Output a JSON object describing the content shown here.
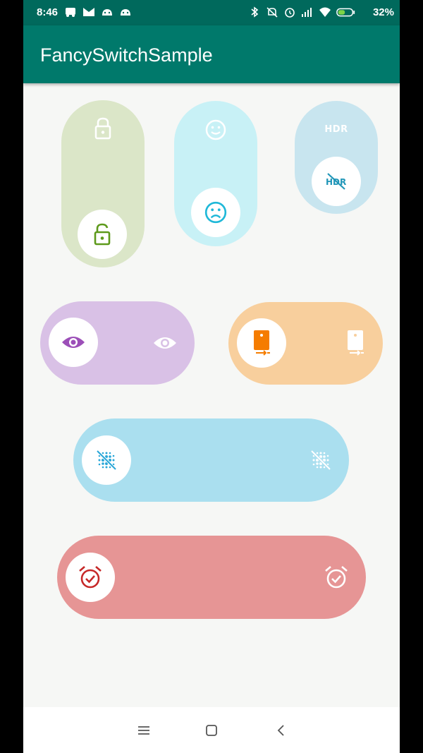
{
  "status_bar": {
    "time": "8:46",
    "battery_percent": "32%",
    "left_icons": [
      "train-icon",
      "mail-icon",
      "android-icon",
      "android-icon"
    ],
    "right_icons": [
      "bluetooth-icon",
      "mute-icon",
      "alarm-icon",
      "signal-icon",
      "wifi-icon",
      "battery-icon"
    ]
  },
  "app_bar": {
    "title": "FancySwitchSample"
  },
  "switches": [
    {
      "name": "lock-switch",
      "color": "#dbe6c8",
      "knob_icon": "lock-open-icon",
      "ghost_icon": "lock-icon",
      "accent": "#5e9a1c",
      "state": "on"
    },
    {
      "name": "mood-switch",
      "color": "#c8f1f6",
      "knob_icon": "sad-face-icon",
      "ghost_icon": "smile-face-icon",
      "accent": "#1fb8d8",
      "state": "on"
    },
    {
      "name": "hdr-switch",
      "color": "#c8e5ef",
      "knob_icon": "hdr-off-icon",
      "ghost_icon": "hdr-icon",
      "ghost_label": "HDR",
      "accent": "#2196b8",
      "state": "on"
    },
    {
      "name": "visibility-switch",
      "color": "#d9c1e6",
      "knob_icon": "eye-icon",
      "ghost_icon": "eye-icon",
      "accent": "#9c4fb8",
      "state": "off"
    },
    {
      "name": "phone-switch",
      "color": "#f8cf9d",
      "knob_icon": "phone-transfer-icon",
      "ghost_icon": "phone-transfer-icon",
      "accent": "#f57c00",
      "state": "off"
    },
    {
      "name": "grain-switch",
      "color": "#aadfef",
      "knob_icon": "blur-off-icon",
      "ghost_icon": "blur-off-icon",
      "accent": "#2aa7d8",
      "state": "off"
    },
    {
      "name": "alarm-switch",
      "color": "#e69595",
      "knob_icon": "alarm-check-icon",
      "ghost_icon": "alarm-check-icon",
      "accent": "#c62828",
      "state": "off"
    }
  ],
  "nav_bar": {
    "buttons": [
      "menu-icon",
      "home-square-icon",
      "back-chevron-icon"
    ]
  }
}
